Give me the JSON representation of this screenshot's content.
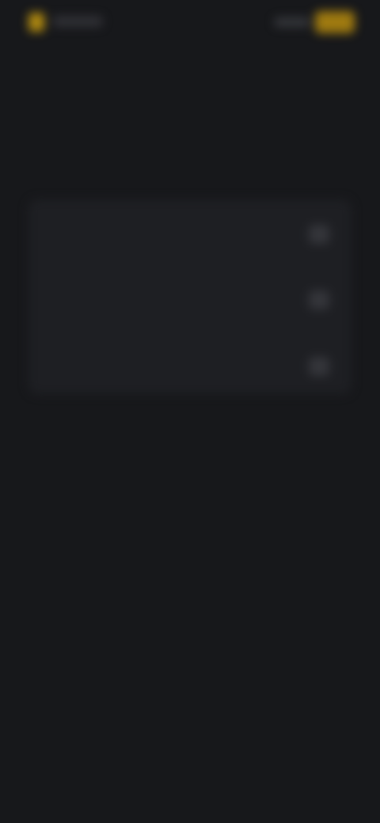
{
  "header": {
    "brand": "",
    "link_label": "",
    "button_label": ""
  },
  "main": {
    "title": "",
    "options": [
      {
        "label": ""
      },
      {
        "label": ""
      },
      {
        "label": ""
      }
    ]
  },
  "colors": {
    "background": "#17181b",
    "card": "#1e1f23",
    "accent": "#f0b90b"
  }
}
